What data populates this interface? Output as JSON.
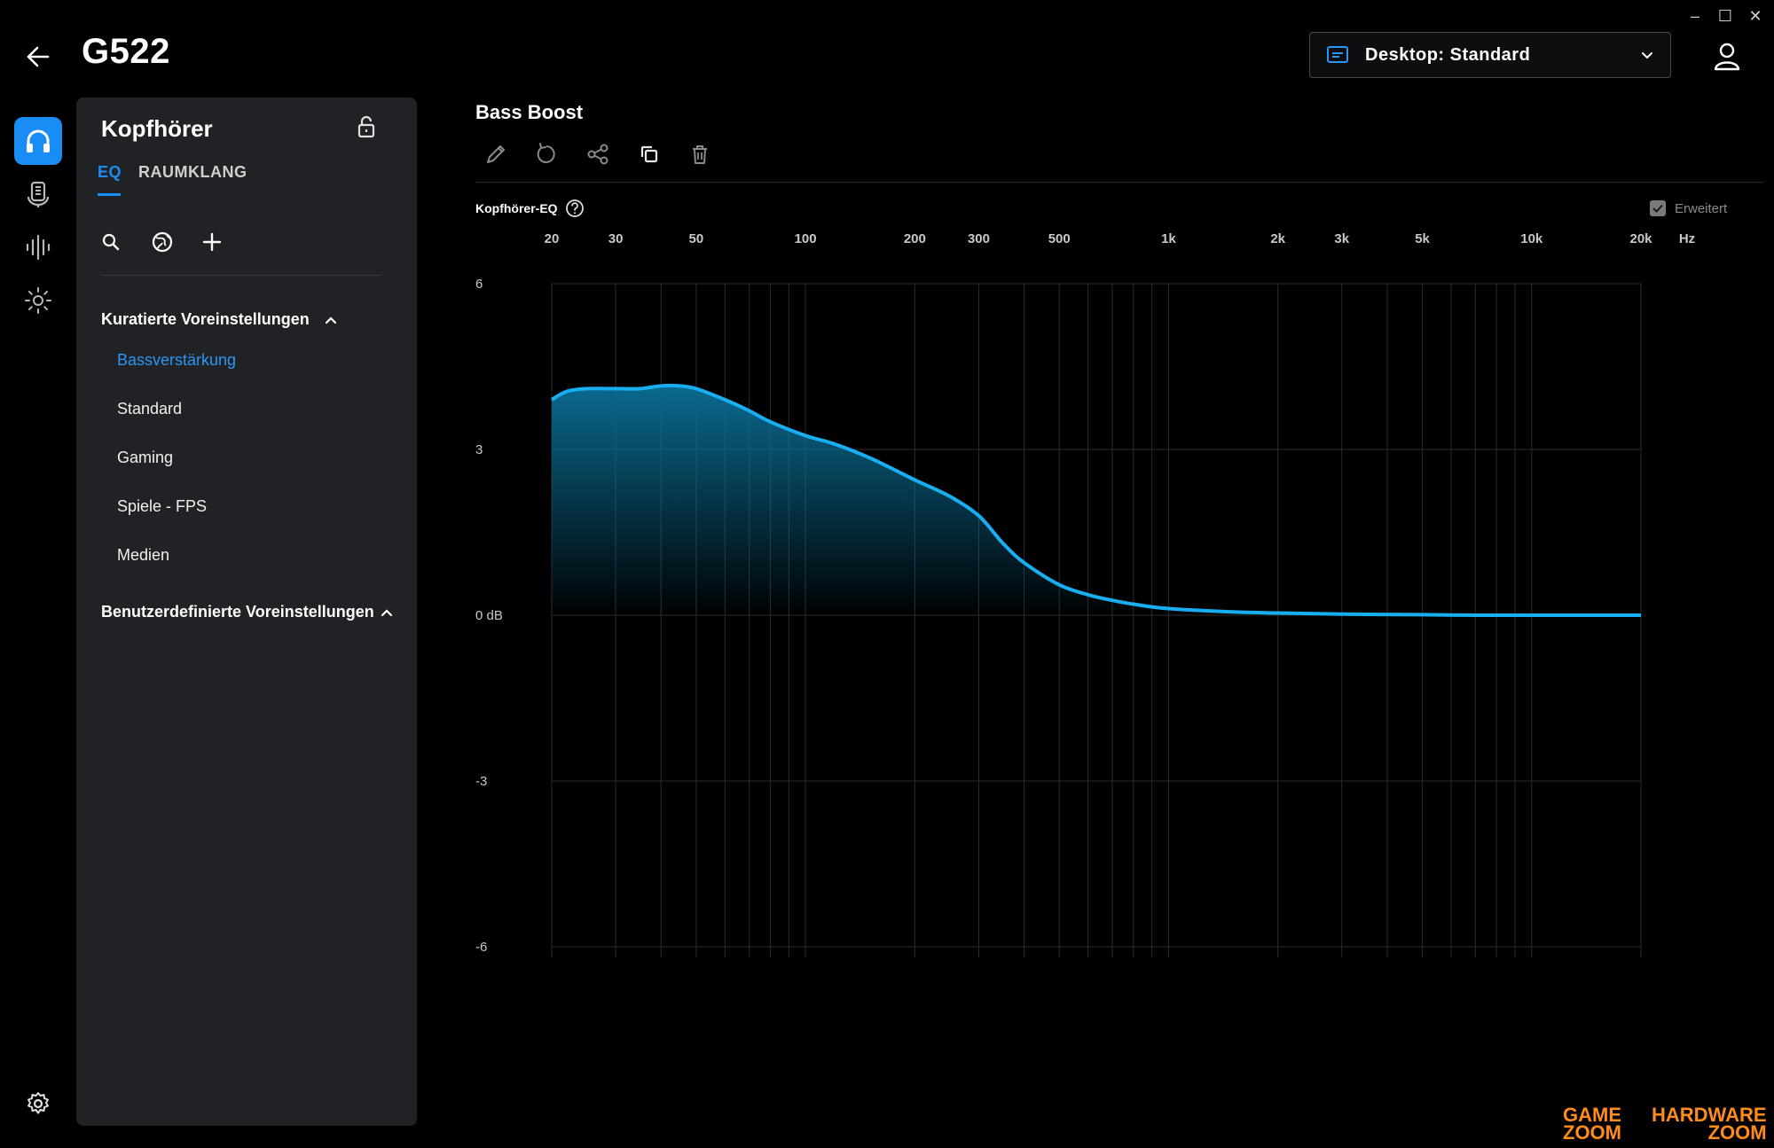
{
  "window": {
    "minimize": "–",
    "maximize": "☐",
    "close": "✕"
  },
  "header": {
    "title": "G522",
    "profile": {
      "label": "Desktop: Standard"
    }
  },
  "sidebar": {
    "rail": [
      {
        "name": "headphones",
        "active": true
      },
      {
        "name": "microphone",
        "active": false
      },
      {
        "name": "equalizer-bars",
        "active": false
      },
      {
        "name": "lighting",
        "active": false
      }
    ]
  },
  "panel": {
    "title": "Kopfhörer",
    "tabs": [
      {
        "label": "EQ"
      },
      {
        "label": "RAUMKLANG"
      }
    ],
    "curated": {
      "label": "Kuratierte Voreinstellungen",
      "items": [
        {
          "label": "Bassverstärkung",
          "selected": true
        },
        {
          "label": "Standard",
          "selected": false
        },
        {
          "label": "Gaming",
          "selected": false
        },
        {
          "label": "Spiele - FPS",
          "selected": false
        },
        {
          "label": "Medien",
          "selected": false
        }
      ]
    },
    "custom": {
      "label": "Benutzerdefinierte Voreinstellungen"
    }
  },
  "main": {
    "title": "Bass Boost",
    "eq_label": "Kopfhörer-EQ",
    "erweitert": {
      "label": "Erweitert",
      "checked": true
    }
  },
  "chart_data": {
    "type": "area",
    "x_scale": "log",
    "x_unit": "Hz",
    "xlim": [
      20,
      20000
    ],
    "ylim": [
      -6,
      6
    ],
    "x_tick_labels": [
      {
        "value": 20,
        "label": "20"
      },
      {
        "value": 30,
        "label": "30"
      },
      {
        "value": 50,
        "label": "50"
      },
      {
        "value": 100,
        "label": "100"
      },
      {
        "value": 200,
        "label": "200"
      },
      {
        "value": 300,
        "label": "300"
      },
      {
        "value": 500,
        "label": "500"
      },
      {
        "value": 1000,
        "label": "1k"
      },
      {
        "value": 2000,
        "label": "2k"
      },
      {
        "value": 3000,
        "label": "3k"
      },
      {
        "value": 5000,
        "label": "5k"
      },
      {
        "value": 10000,
        "label": "10k"
      },
      {
        "value": 20000,
        "label": "20k"
      }
    ],
    "y_tick_labels": [
      {
        "value": 6,
        "label": "6"
      },
      {
        "value": 3,
        "label": "3"
      },
      {
        "value": 0,
        "label": "0 dB"
      },
      {
        "value": -3,
        "label": "-3"
      },
      {
        "value": -6,
        "label": "-6"
      }
    ],
    "x": [
      20,
      22,
      25,
      30,
      35,
      40,
      45,
      50,
      60,
      70,
      80,
      100,
      120,
      150,
      200,
      250,
      300,
      350,
      400,
      500,
      600,
      700,
      800,
      1000,
      1500,
      2000,
      3000,
      5000,
      7000,
      10000,
      20000
    ],
    "y": [
      3.9,
      4.05,
      4.1,
      4.1,
      4.1,
      4.15,
      4.15,
      4.1,
      3.9,
      3.7,
      3.5,
      3.25,
      3.1,
      2.85,
      2.45,
      2.15,
      1.8,
      1.3,
      0.95,
      0.55,
      0.37,
      0.27,
      0.2,
      0.12,
      0.06,
      0.04,
      0.02,
      0.01,
      0.0,
      0.0,
      0.0
    ],
    "line_color": "#18aef2",
    "fill_color": "#0a6f96",
    "grid": true
  }
}
